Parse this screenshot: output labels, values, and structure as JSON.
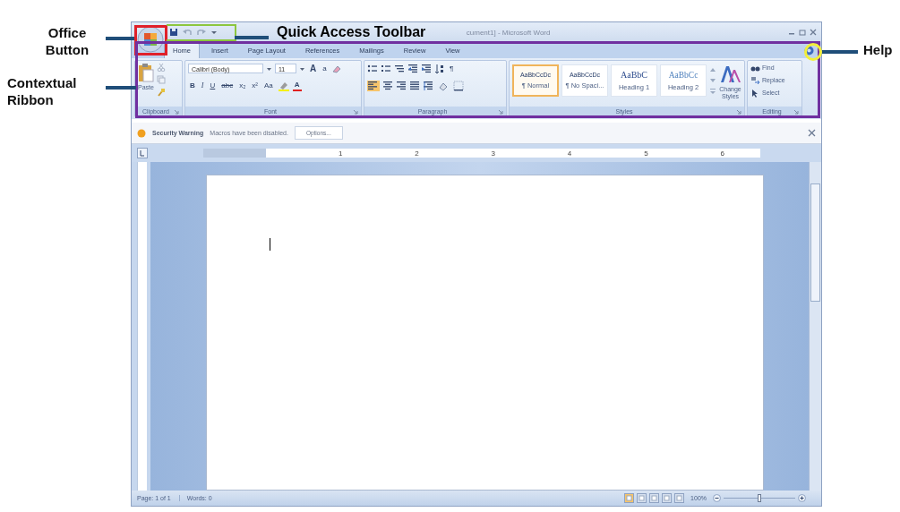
{
  "annotations": [
    {
      "text": "Office Button"
    },
    {
      "text": "Quick Access Toolbar"
    },
    {
      "text": "Contextual Ribbon"
    },
    {
      "text": "Help"
    }
  ],
  "window": {
    "title": "cument1] - Microsoft Word"
  },
  "tabs": [
    {
      "label": "Home",
      "selected": true
    },
    {
      "label": "Insert",
      "selected": false
    },
    {
      "label": "Page Layout",
      "selected": false
    },
    {
      "label": "References",
      "selected": false
    },
    {
      "label": "Mailings",
      "selected": false
    },
    {
      "label": "Review",
      "selected": false
    },
    {
      "label": "View",
      "selected": false
    }
  ],
  "ribbon": {
    "clipboard": {
      "name": "Clipboard",
      "paste": "Paste"
    },
    "font": {
      "name": "Font",
      "font_name": "Calibri (Body)",
      "font_size": "11",
      "grow": "A",
      "shrink": "a",
      "format_buttons": [
        "B",
        "I",
        "U",
        "abc",
        "x₂",
        "x²",
        "Aa"
      ],
      "color_button": "A"
    },
    "paragraph": {
      "name": "Paragraph",
      "show_marks": "¶"
    },
    "styles": {
      "name": "Styles",
      "items": [
        {
          "preview": "AaBbCcDc",
          "label": "¶ Normal",
          "selected": true
        },
        {
          "preview": "AaBbCcDc",
          "label": "¶ No Spaci...",
          "selected": false
        },
        {
          "preview": "AaBbC",
          "label": "Heading 1",
          "selected": false
        },
        {
          "preview": "AaBbCc",
          "label": "Heading 2",
          "selected": false
        }
      ],
      "change_styles": "Change Styles"
    },
    "editing": {
      "name": "Editing",
      "items": [
        "Find",
        "Replace",
        "Select"
      ]
    }
  },
  "security_bar": {
    "label": "Security Warning",
    "message": "Macros have been disabled.",
    "button": "Options..."
  },
  "ruler": {
    "marks": [
      "1",
      "2",
      "3",
      "4",
      "5",
      "6"
    ]
  },
  "status_bar": {
    "page": "Page: 1 of 1",
    "words": "Words: 0",
    "zoom": "100%",
    "zoom_level": {
      "level": 0.5
    }
  }
}
